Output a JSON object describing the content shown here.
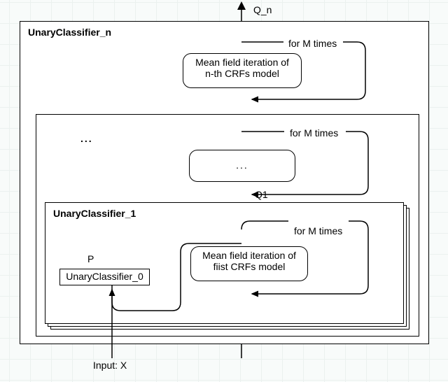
{
  "output_label": "Q_n",
  "outer_title": "UnaryClassifier_n",
  "loop_n_label": "for M times",
  "block_n_text_line1": "Mean field iteration of",
  "block_n_text_line2": "n-th CRFs model",
  "ellipsis_title": "...",
  "loop_mid_label": "for M times",
  "block_mid_text": "...",
  "q1_label": "Q1",
  "inner_title": "UnaryClassifier_1",
  "loop_1_label": "for M times",
  "block_1_text_line1": "Mean field iteration of",
  "block_1_text_line2": "fiist CRFs model",
  "p_label": "P",
  "uc0_label": "UnaryClassifier_0",
  "input_label": "Input: X"
}
